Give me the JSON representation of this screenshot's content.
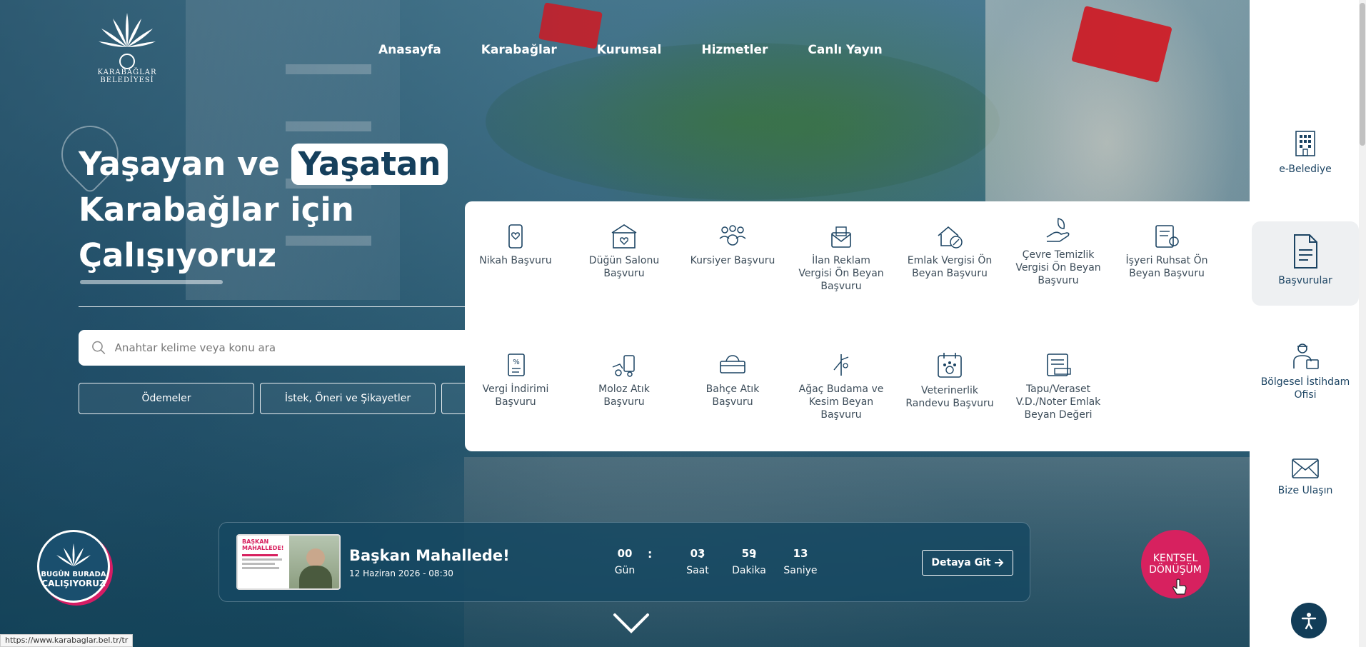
{
  "logo": {
    "text": "KARABAĞLAR BELEDİYESİ"
  },
  "nav": [
    {
      "label": "Anasayfa"
    },
    {
      "label": "Karabağlar"
    },
    {
      "label": "Kurumsal"
    },
    {
      "label": "Hizmetler"
    },
    {
      "label": "Canlı Yayın"
    }
  ],
  "headline": {
    "part1": "Yaşayan ve",
    "highlight": "Yaşatan",
    "line2": "Karabağlar için",
    "line3": "Çalışıyoruz"
  },
  "search": {
    "placeholder": "Anahtar kelime veya konu ara"
  },
  "quick_buttons": [
    {
      "label": "Ödemeler"
    },
    {
      "label": "İstek, Öneri ve Şikayetler"
    }
  ],
  "services": [
    {
      "label": "Nikah Başvuru",
      "icon": "phone-heart-icon"
    },
    {
      "label": "Düğün Salonu Başvuru",
      "icon": "wedding-hall-icon"
    },
    {
      "label": "Kursiyer Başvuru",
      "icon": "group-icon"
    },
    {
      "label": "İlan Reklam Vergisi Ön Beyan Başvuru",
      "icon": "envelope-icon"
    },
    {
      "label": "Emlak Vergisi Ön Beyan Başvuru",
      "icon": "house-percent-icon"
    },
    {
      "label": "Çevre Temizlik Vergisi Ön Beyan Başvuru",
      "icon": "hand-leaf-icon"
    },
    {
      "label": "İşyeri Ruhsat Ön Beyan Başvuru",
      "icon": "license-icon"
    },
    {
      "label": "Vergi İndirimi Başvuru",
      "icon": "tax-document-icon"
    },
    {
      "label": "Moloz Atık Başvuru",
      "icon": "debris-icon"
    },
    {
      "label": "Bahçe Atık Başvuru",
      "icon": "garden-waste-icon"
    },
    {
      "label": "Ağaç Budama ve Kesim Beyan Başvuru",
      "icon": "pruning-icon"
    },
    {
      "label": "Veterinerlik Randevu Başvuru",
      "icon": "paw-calendar-icon"
    },
    {
      "label": "Tapu/Veraset V.D./Noter Emlak Beyan Değeri",
      "icon": "deed-icon"
    }
  ],
  "sidebar": [
    {
      "label": "e-Belediye",
      "icon": "building-icon"
    },
    {
      "label": "Başvurular",
      "icon": "document-icon"
    },
    {
      "label": "Bölgesel İstihdam Ofisi",
      "icon": "worker-icon"
    },
    {
      "label": "Bize Ulaşın",
      "icon": "mail-icon"
    }
  ],
  "badge": {
    "line1": "BUGÜN BURADA",
    "line2": "ÇALIŞIYORUZ"
  },
  "event": {
    "title": "Başkan Mahallede!",
    "date": "12 Haziran 2026 - 08:30",
    "thumb_title": "BAŞKAN MAHALLEDE!",
    "countdown": [
      {
        "value": "00",
        "label": "Gün"
      },
      {
        "value": "03",
        "label": "Saat"
      },
      {
        "value": "59",
        "label": "Dakika"
      },
      {
        "value": "13",
        "label": "Saniye"
      }
    ],
    "button": "Detaya Git"
  },
  "kentsel": {
    "line1": "KENTSEL",
    "line2": "DÖNÜŞÜM"
  },
  "status_url": "https://www.karabaglar.bel.tr/tr",
  "colors": {
    "navy": "#153f5c",
    "accent_pink": "#d7215f",
    "icon_blue": "#1c4463"
  }
}
